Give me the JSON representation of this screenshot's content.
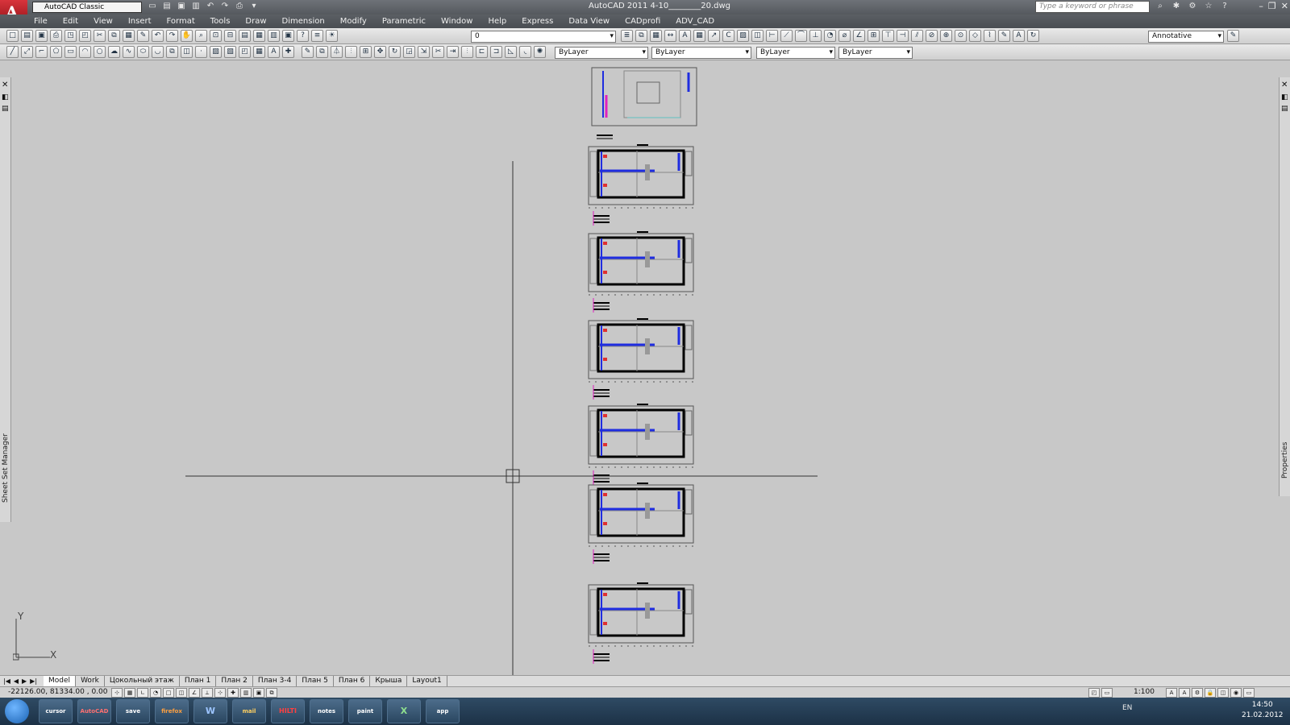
{
  "titlebar": {
    "workspace": "AutoCAD Classic",
    "app_title": "AutoCAD 2011   4-10________20.dwg",
    "search_placeholder": "Type a keyword or phrase"
  },
  "menu": [
    "File",
    "Edit",
    "View",
    "Insert",
    "Format",
    "Tools",
    "Draw",
    "Dimension",
    "Modify",
    "Parametric",
    "Window",
    "Help",
    "Express",
    "Data View",
    "CADprofi",
    "ADV_CAD"
  ],
  "toolbar": {
    "layer_value": "0",
    "annotative": "Annotative",
    "color": "ByLayer",
    "linetype": "ByLayer",
    "lineweight": "ByLayer",
    "plotstyle": "ByLayer"
  },
  "palettes": {
    "left": "Sheet Set Manager",
    "right": "Properties"
  },
  "tabs": [
    "Model",
    "Work",
    "Цокольный этаж",
    "План 1",
    "План 2",
    "План 3-4",
    "План 5",
    "План 6",
    "Крыша",
    "Layout1"
  ],
  "status": {
    "coords": "-22126.00, 81334.00 , 0.00",
    "scale": "1:100"
  },
  "taskbar": {
    "lang": "EN",
    "time": "14:50",
    "date": "21.02.2012",
    "apps": [
      "cursor",
      "AutoCAD",
      "save",
      "firefox",
      "W",
      "mail",
      "HILTI",
      "notes",
      "paint",
      "X",
      "app"
    ]
  },
  "ucs": {
    "y": "Y",
    "x": "X"
  },
  "colors": {
    "pipe_blue": "#1f2de0",
    "wall": "#000000",
    "accent_magenta": "#e020c0"
  }
}
